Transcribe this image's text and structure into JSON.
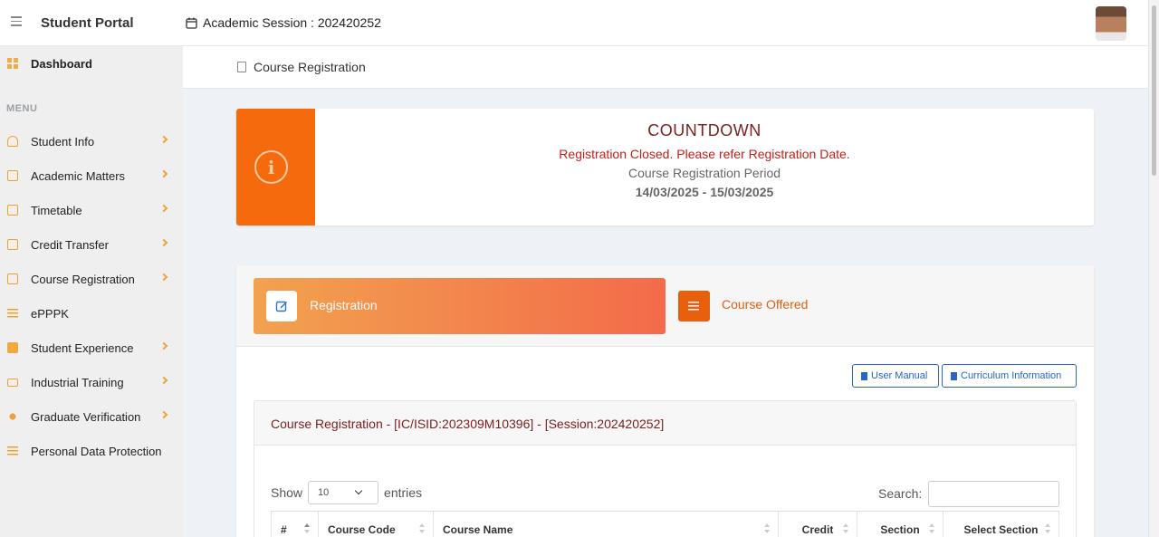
{
  "header": {
    "brand": "Student Portal",
    "session": "Academic Session : 202420252"
  },
  "sidebar": {
    "dashboard": "Dashboard",
    "menu_title": "MENU",
    "items": [
      {
        "label": "Student Info",
        "icon": "user-icon",
        "chevron": true
      },
      {
        "label": "Academic Matters",
        "icon": "layout-icon",
        "chevron": true
      },
      {
        "label": "Timetable",
        "icon": "calendar-icon",
        "chevron": true
      },
      {
        "label": "Credit Transfer",
        "icon": "document-icon",
        "chevron": true
      },
      {
        "label": "Course Registration",
        "icon": "clipboard-icon",
        "chevron": true
      },
      {
        "label": "ePPPK",
        "icon": "list-icon",
        "chevron": false
      },
      {
        "label": "Student Experience",
        "icon": "cube-icon",
        "chevron": true
      },
      {
        "label": "Industrial Training",
        "icon": "monitor-icon",
        "chevron": true
      },
      {
        "label": "Graduate Verification",
        "icon": "flower-icon",
        "chevron": true
      },
      {
        "label": "Personal Data Protection",
        "icon": "list-icon",
        "chevron": false
      }
    ]
  },
  "breadcrumb": {
    "label": "Course Registration"
  },
  "countdown": {
    "title": "COUNTDOWN",
    "status": "Registration Closed. Please refer Registration Date.",
    "period_label": "Course Registration Period",
    "dates": "14/03/2025 - 15/03/2025"
  },
  "tabs": {
    "registration": "Registration",
    "offered": "Course Offered"
  },
  "buttons": {
    "manual": "User Manual",
    "curriculum": "Curriculum Information"
  },
  "table": {
    "title": "Course Registration - [IC/ISID:202309M10396] - [Session:202420252]",
    "show_label": "Show",
    "entries_label": "entries",
    "page_size": "10",
    "search_label": "Search:",
    "columns": [
      "#",
      "Course Code",
      "Course Name",
      "Credit",
      "Section",
      "Select Section"
    ]
  },
  "colors": {
    "accent": "#f56a0d",
    "title_red": "#7a1e1e",
    "status_red": "#c0201a",
    "link_blue": "#2a63c4"
  }
}
